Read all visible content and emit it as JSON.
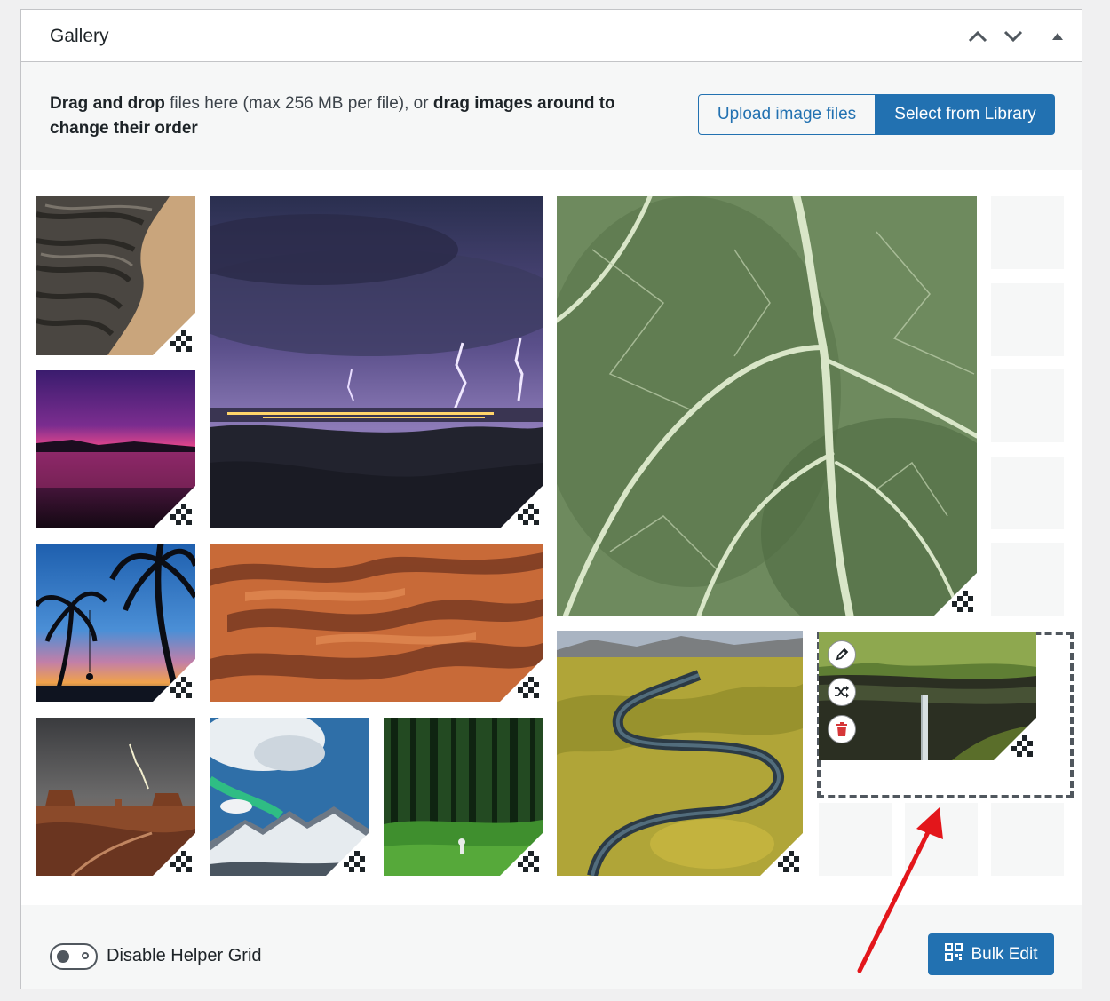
{
  "panel": {
    "title": "Gallery",
    "move_up_label": "Move up",
    "move_down_label": "Move down",
    "toggle_label": "Toggle panel"
  },
  "notice": {
    "drag_drop": "Drag and drop",
    "middle": " files here (max 256 MB per file), or ",
    "drag_images": "drag images around to",
    "end": "change their order"
  },
  "buttons": {
    "upload": "Upload image files",
    "library": "Select from Library",
    "bulk_edit": "Bulk Edit"
  },
  "footer": {
    "helper_grid_label": "Disable Helper Grid"
  },
  "icons": {
    "expand": "chevron-up-icon",
    "collapse": "chevron-down-icon",
    "panel_toggle": "triangle-up-icon",
    "resize": "resize-handle-icon",
    "edit": "pencil-icon",
    "replace": "shuffle-icon",
    "delete": "trash-icon",
    "bulk": "qr-grid-icon"
  },
  "colors": {
    "accent": "#2271b1",
    "delete": "#d63638",
    "arrow": "#e3161b"
  },
  "images": [
    {
      "name": "thumb-eroded-terrain"
    },
    {
      "name": "thumb-lightning-night"
    },
    {
      "name": "thumb-green-leaf"
    },
    {
      "name": "thumb-pink-sunset-lake"
    },
    {
      "name": "thumb-palm-trees-swing"
    },
    {
      "name": "thumb-sand-dunes"
    },
    {
      "name": "thumb-river-meadow"
    },
    {
      "name": "thumb-waterfall-cliff"
    },
    {
      "name": "thumb-monument-valley-storm"
    },
    {
      "name": "thumb-aurora-snow-mountains"
    },
    {
      "name": "thumb-green-forest"
    }
  ]
}
